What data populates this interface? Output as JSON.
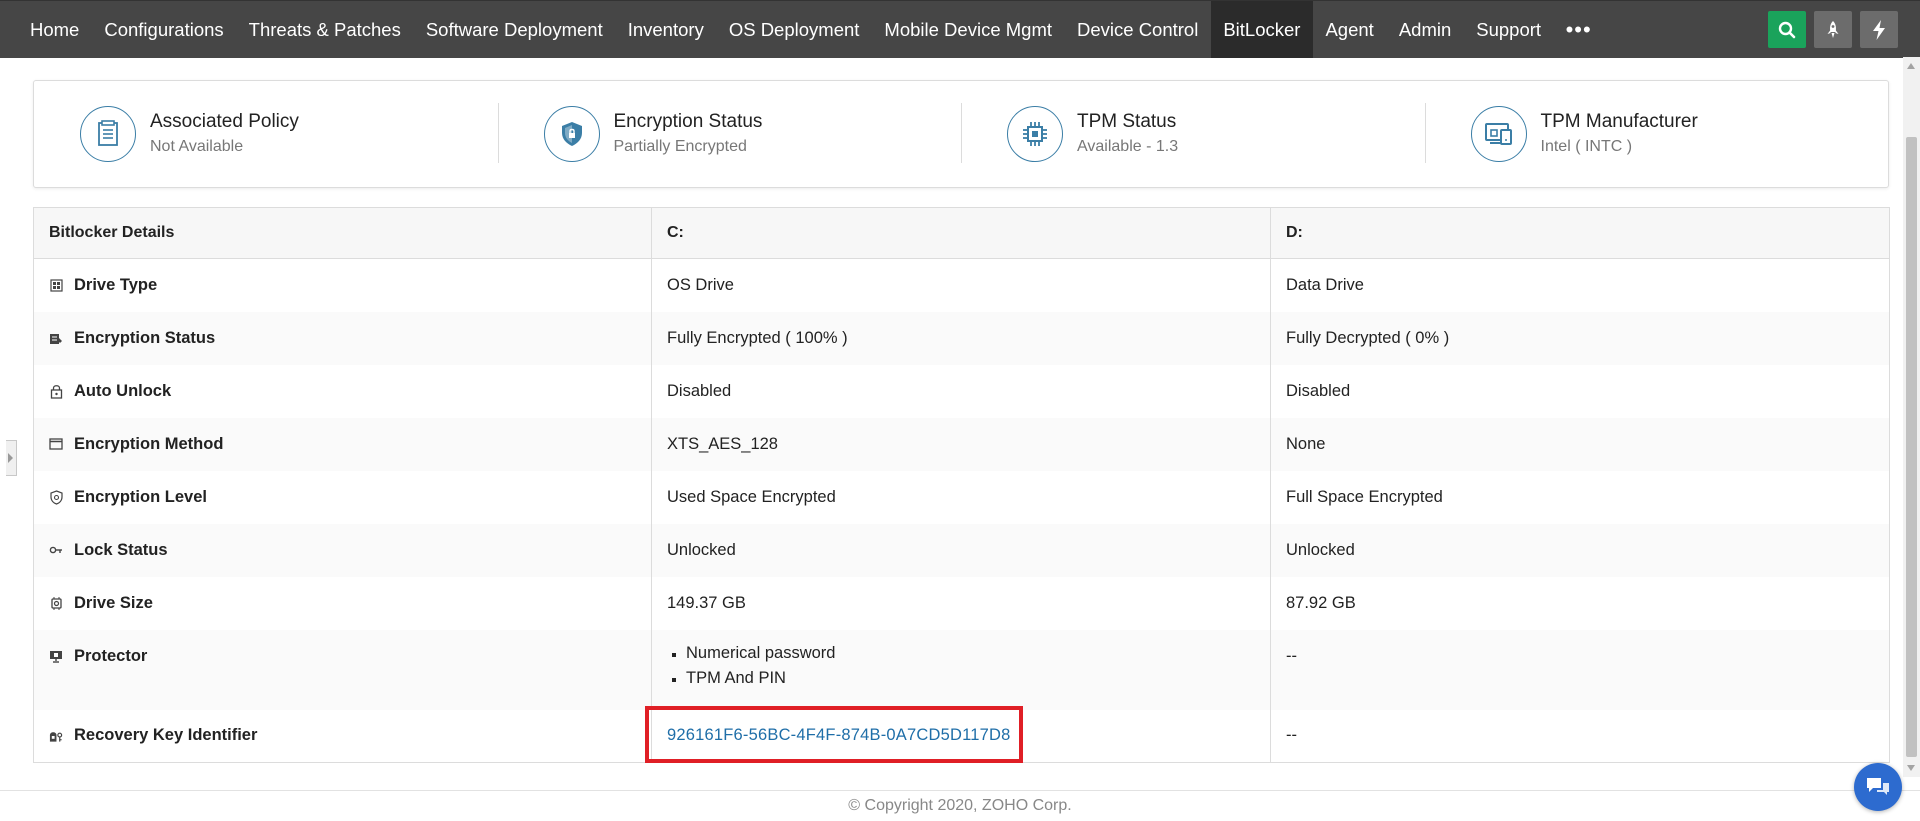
{
  "nav": {
    "items": [
      {
        "label": "Home"
      },
      {
        "label": "Configurations"
      },
      {
        "label": "Threats & Patches"
      },
      {
        "label": "Software Deployment"
      },
      {
        "label": "Inventory"
      },
      {
        "label": "OS Deployment"
      },
      {
        "label": "Mobile Device Mgmt"
      },
      {
        "label": "Device Control"
      },
      {
        "label": "BitLocker"
      },
      {
        "label": "Agent"
      },
      {
        "label": "Admin"
      },
      {
        "label": "Support"
      }
    ],
    "active": "BitLocker",
    "more_label": "•••",
    "right_icons": [
      "search-icon",
      "rocket-icon",
      "lightning-icon"
    ]
  },
  "summary": {
    "cards": [
      {
        "icon": "policy-document-icon",
        "title": "Associated Policy",
        "value": "Not Available"
      },
      {
        "icon": "shield-icon",
        "title": "Encryption Status",
        "value": "Partially Encrypted"
      },
      {
        "icon": "chip-icon",
        "title": "TPM Status",
        "value": "Available - 1.3"
      },
      {
        "icon": "devices-icon",
        "title": "TPM Manufacturer",
        "value": "Intel ( INTC )"
      }
    ]
  },
  "details": {
    "headers": [
      "Bitlocker Details",
      "C:",
      "D:"
    ],
    "rows": [
      {
        "icon": "drive-icon",
        "label": "Drive Type",
        "c": "OS Drive",
        "d": "Data Drive"
      },
      {
        "icon": "encryption-icon",
        "label": "Encryption Status",
        "c": "Fully Encrypted ( 100% )",
        "d": "Fully Decrypted ( 0% )"
      },
      {
        "icon": "lock-icon",
        "label": "Auto Unlock",
        "c": "Disabled",
        "d": "Disabled"
      },
      {
        "icon": "window-icon",
        "label": "Encryption Method",
        "c": "XTS_AES_128",
        "d": "None"
      },
      {
        "icon": "shield-level-icon",
        "label": "Encryption Level",
        "c": "Used Space Encrypted",
        "d": "Full Space Encrypted"
      },
      {
        "icon": "key-icon",
        "label": "Lock Status",
        "c": "Unlocked",
        "d": "Unlocked"
      },
      {
        "icon": "disk-icon",
        "label": "Drive Size",
        "c": "149.37 GB",
        "d": "87.92 GB"
      },
      {
        "icon": "monitor-icon",
        "label": "Protector",
        "c_list": [
          "Numerical password",
          "TPM And PIN"
        ],
        "d": "--"
      },
      {
        "icon": "recovery-key-icon",
        "label": "Recovery Key Identifier",
        "c": "926161F6-56BC-4F4F-874B-0A7CD5D117D8",
        "d": "--"
      }
    ]
  },
  "footer": {
    "copyright": "© Copyright 2020, ZOHO Corp."
  },
  "colors": {
    "nav_bg": "#464646",
    "nav_active": "#2b2b2b",
    "accent": "#1aa35b",
    "link": "#1f6ea8",
    "highlight": "#e01f26",
    "icon": "#3b7ea6"
  }
}
